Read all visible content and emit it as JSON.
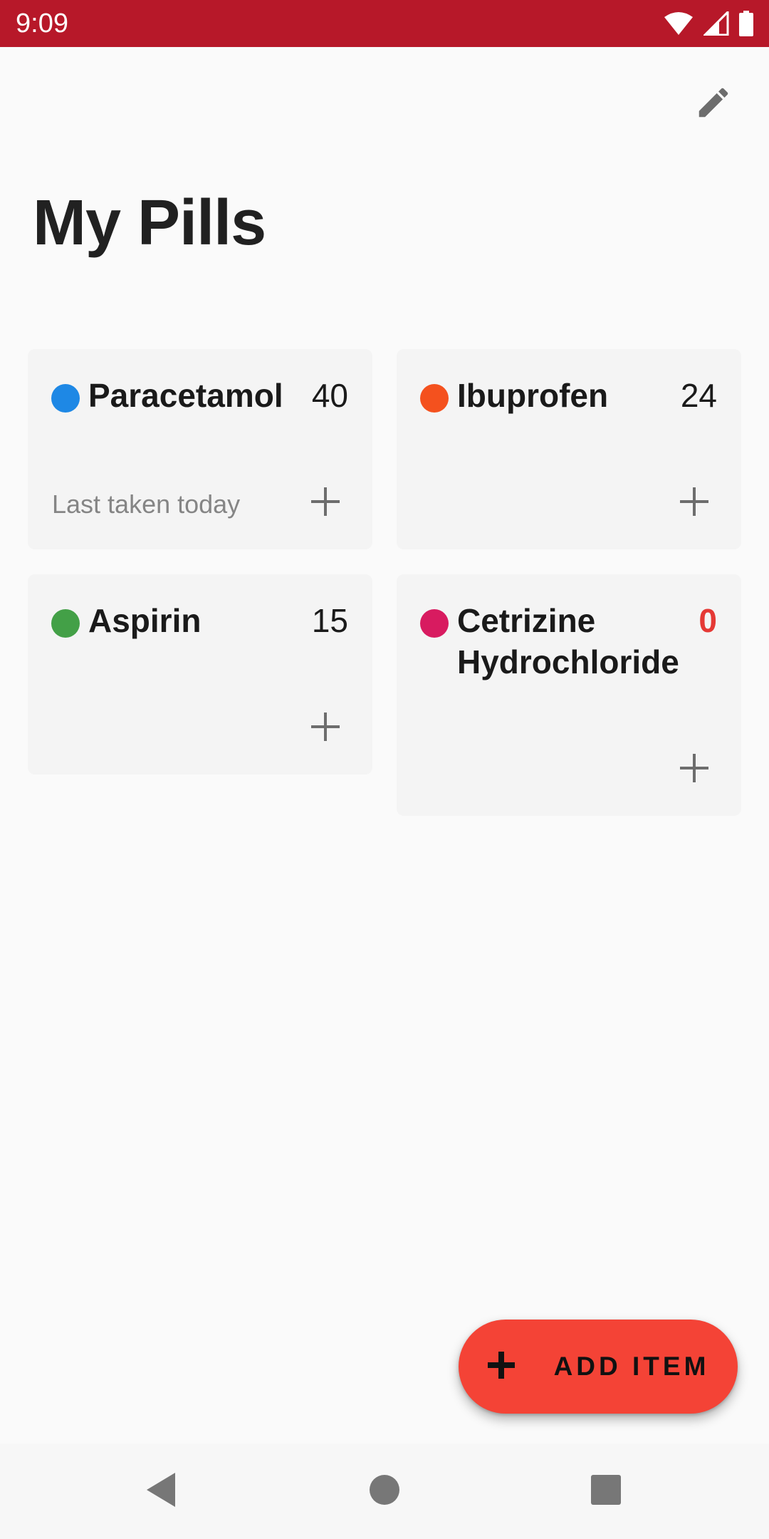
{
  "status_bar": {
    "time": "9:09",
    "background": "#b71829",
    "icons": [
      "wifi-icon",
      "signal-icon",
      "battery-icon"
    ]
  },
  "header": {
    "title": "My Pills",
    "edit_icon": "pencil-icon"
  },
  "pills": [
    {
      "name": "Paracetamol",
      "count": "40",
      "color": "#1e88e5",
      "last_taken": "Last taken today"
    },
    {
      "name": "Ibuprofen",
      "count": "24",
      "color": "#f4511e",
      "last_taken": ""
    },
    {
      "name": "Aspirin",
      "count": "15",
      "color": "#43a047",
      "last_taken": ""
    },
    {
      "name": "Cetrizine Hydrochloride",
      "count": "0",
      "color": "#d81b60",
      "last_taken": ""
    }
  ],
  "fab": {
    "label": "ADD ITEM",
    "icon": "plus-icon",
    "color": "#f44336"
  },
  "nav_bar": {
    "icons": [
      "back-icon",
      "home-icon",
      "recents-icon"
    ]
  }
}
